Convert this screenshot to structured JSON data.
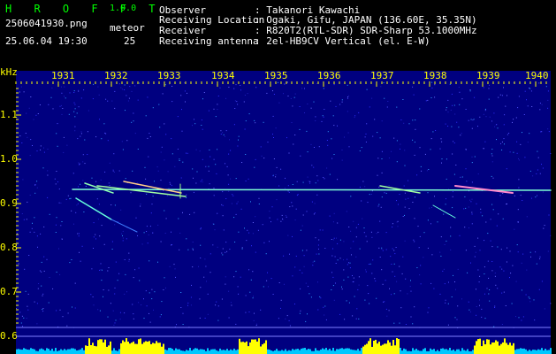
{
  "header": {
    "app_name": "H R O F F T",
    "version": "1.0.0",
    "filename": "2506041930.png",
    "datetime": "25.06.04 19:30",
    "meteor_label": "meteor",
    "meteor_count": "25",
    "info": [
      {
        "key": "Observer",
        "value": ": Takanori Kawachi"
      },
      {
        "key": "Receiving Location",
        "value": ": Ogaki, Gifu, JAPAN (136.60E, 35.35N)"
      },
      {
        "key": "Receiver",
        "value": ": R820T2(RTL-SDR) SDR-Sharp 53.1000MHz"
      },
      {
        "key": "Receiving antenna",
        "value": ": 2el-HB9CV Vertical (el. E-W)"
      }
    ]
  },
  "spectrogram": {
    "y_unit": "kHz",
    "x_ticks": [
      "1931",
      "1932",
      "1933",
      "1934",
      "1935",
      "1936",
      "1937",
      "1938",
      "1939",
      "1940"
    ],
    "y_ticks": [
      "1.1",
      "1.0",
      "0.9",
      "0.8",
      "0.7",
      "0.6"
    ],
    "colors": {
      "background": "#000080",
      "text": "#ffff00",
      "trace": "#7fffd4",
      "activity": "#ffff00"
    }
  }
}
